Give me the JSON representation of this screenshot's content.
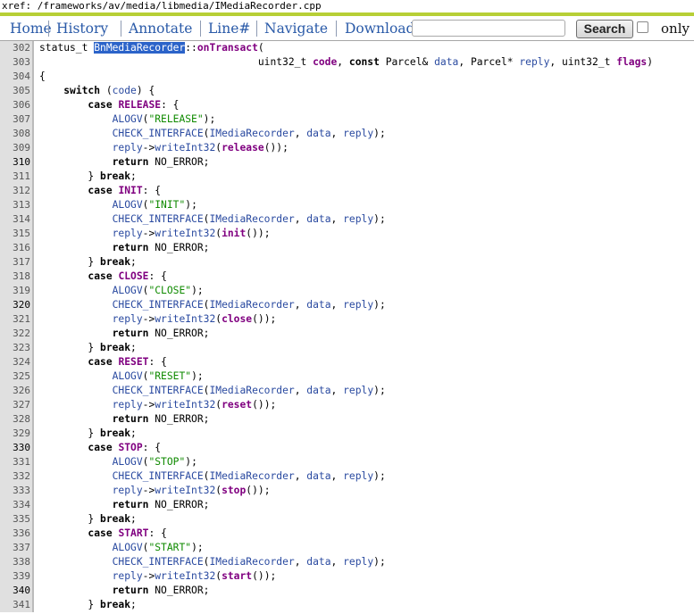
{
  "xref_path": "xref: /frameworks/av/media/libmedia/IMediaRecorder.cpp",
  "nav": {
    "home": "Home",
    "history": "History",
    "annotate": "Annotate",
    "line": "Line#",
    "navigate": "Navigate",
    "download": "Download",
    "search_button": "Search",
    "search_value": "",
    "only_label": "only"
  },
  "colors": {
    "accent_bar": "#b7cf36",
    "link": "#2a5aa8",
    "gutter": "#e0e0e0",
    "highlight": "#2b63c9"
  },
  "code": [
    {
      "n": "302",
      "s": [
        [
          "t",
          "status_t "
        ],
        [
          "hl",
          "BnMediaRecorder"
        ],
        [
          "t",
          "::"
        ],
        [
          "fn",
          "onTransact"
        ],
        [
          "t",
          "("
        ]
      ]
    },
    {
      "n": "303",
      "s": [
        [
          "t",
          "                                    uint32_t "
        ],
        [
          "fn",
          "code"
        ],
        [
          "t",
          ", "
        ],
        [
          "kw",
          "const"
        ],
        [
          "t",
          " Parcel& "
        ],
        [
          "id",
          "data"
        ],
        [
          "t",
          ", Parcel* "
        ],
        [
          "id",
          "reply"
        ],
        [
          "t",
          ", uint32_t "
        ],
        [
          "fn",
          "flags"
        ],
        [
          "t",
          ")"
        ]
      ]
    },
    {
      "n": "304",
      "s": [
        [
          "t",
          "{"
        ]
      ]
    },
    {
      "n": "305",
      "s": [
        [
          "t",
          "    "
        ],
        [
          "kw",
          "switch"
        ],
        [
          "t",
          " ("
        ],
        [
          "id",
          "code"
        ],
        [
          "t",
          ") {"
        ]
      ]
    },
    {
      "n": "306",
      "s": [
        [
          "t",
          "        "
        ],
        [
          "kw",
          "case"
        ],
        [
          "t",
          " "
        ],
        [
          "fn",
          "RELEASE"
        ],
        [
          "t",
          ": {"
        ]
      ]
    },
    {
      "n": "307",
      "s": [
        [
          "t",
          "            "
        ],
        [
          "id",
          "ALOGV"
        ],
        [
          "t",
          "("
        ],
        [
          "str",
          "\"RELEASE\""
        ],
        [
          "t",
          ");"
        ]
      ]
    },
    {
      "n": "308",
      "s": [
        [
          "t",
          "            "
        ],
        [
          "id",
          "CHECK_INTERFACE"
        ],
        [
          "t",
          "("
        ],
        [
          "id",
          "IMediaRecorder"
        ],
        [
          "t",
          ", "
        ],
        [
          "id",
          "data"
        ],
        [
          "t",
          ", "
        ],
        [
          "id",
          "reply"
        ],
        [
          "t",
          ");"
        ]
      ]
    },
    {
      "n": "309",
      "s": [
        [
          "t",
          "            "
        ],
        [
          "id",
          "reply"
        ],
        [
          "t",
          "->"
        ],
        [
          "id",
          "writeInt32"
        ],
        [
          "t",
          "("
        ],
        [
          "fn",
          "release"
        ],
        [
          "t",
          "());"
        ]
      ]
    },
    {
      "n": "310",
      "m": true,
      "s": [
        [
          "t",
          "            "
        ],
        [
          "kw",
          "return"
        ],
        [
          "t",
          " NO_ERROR;"
        ]
      ]
    },
    {
      "n": "311",
      "s": [
        [
          "t",
          "        } "
        ],
        [
          "kw",
          "break"
        ],
        [
          "t",
          ";"
        ]
      ]
    },
    {
      "n": "312",
      "s": [
        [
          "t",
          "        "
        ],
        [
          "kw",
          "case"
        ],
        [
          "t",
          " "
        ],
        [
          "fn",
          "INIT"
        ],
        [
          "t",
          ": {"
        ]
      ]
    },
    {
      "n": "313",
      "s": [
        [
          "t",
          "            "
        ],
        [
          "id",
          "ALOGV"
        ],
        [
          "t",
          "("
        ],
        [
          "str",
          "\"INIT\""
        ],
        [
          "t",
          ");"
        ]
      ]
    },
    {
      "n": "314",
      "s": [
        [
          "t",
          "            "
        ],
        [
          "id",
          "CHECK_INTERFACE"
        ],
        [
          "t",
          "("
        ],
        [
          "id",
          "IMediaRecorder"
        ],
        [
          "t",
          ", "
        ],
        [
          "id",
          "data"
        ],
        [
          "t",
          ", "
        ],
        [
          "id",
          "reply"
        ],
        [
          "t",
          ");"
        ]
      ]
    },
    {
      "n": "315",
      "s": [
        [
          "t",
          "            "
        ],
        [
          "id",
          "reply"
        ],
        [
          "t",
          "->"
        ],
        [
          "id",
          "writeInt32"
        ],
        [
          "t",
          "("
        ],
        [
          "fn",
          "init"
        ],
        [
          "t",
          "());"
        ]
      ]
    },
    {
      "n": "316",
      "s": [
        [
          "t",
          "            "
        ],
        [
          "kw",
          "return"
        ],
        [
          "t",
          " NO_ERROR;"
        ]
      ]
    },
    {
      "n": "317",
      "s": [
        [
          "t",
          "        } "
        ],
        [
          "kw",
          "break"
        ],
        [
          "t",
          ";"
        ]
      ]
    },
    {
      "n": "318",
      "s": [
        [
          "t",
          "        "
        ],
        [
          "kw",
          "case"
        ],
        [
          "t",
          " "
        ],
        [
          "fn",
          "CLOSE"
        ],
        [
          "t",
          ": {"
        ]
      ]
    },
    {
      "n": "319",
      "s": [
        [
          "t",
          "            "
        ],
        [
          "id",
          "ALOGV"
        ],
        [
          "t",
          "("
        ],
        [
          "str",
          "\"CLOSE\""
        ],
        [
          "t",
          ");"
        ]
      ]
    },
    {
      "n": "320",
      "m": true,
      "s": [
        [
          "t",
          "            "
        ],
        [
          "id",
          "CHECK_INTERFACE"
        ],
        [
          "t",
          "("
        ],
        [
          "id",
          "IMediaRecorder"
        ],
        [
          "t",
          ", "
        ],
        [
          "id",
          "data"
        ],
        [
          "t",
          ", "
        ],
        [
          "id",
          "reply"
        ],
        [
          "t",
          ");"
        ]
      ]
    },
    {
      "n": "321",
      "s": [
        [
          "t",
          "            "
        ],
        [
          "id",
          "reply"
        ],
        [
          "t",
          "->"
        ],
        [
          "id",
          "writeInt32"
        ],
        [
          "t",
          "("
        ],
        [
          "fn",
          "close"
        ],
        [
          "t",
          "());"
        ]
      ]
    },
    {
      "n": "322",
      "s": [
        [
          "t",
          "            "
        ],
        [
          "kw",
          "return"
        ],
        [
          "t",
          " NO_ERROR;"
        ]
      ]
    },
    {
      "n": "323",
      "s": [
        [
          "t",
          "        } "
        ],
        [
          "kw",
          "break"
        ],
        [
          "t",
          ";"
        ]
      ]
    },
    {
      "n": "324",
      "s": [
        [
          "t",
          "        "
        ],
        [
          "kw",
          "case"
        ],
        [
          "t",
          " "
        ],
        [
          "fn",
          "RESET"
        ],
        [
          "t",
          ": {"
        ]
      ]
    },
    {
      "n": "325",
      "s": [
        [
          "t",
          "            "
        ],
        [
          "id",
          "ALOGV"
        ],
        [
          "t",
          "("
        ],
        [
          "str",
          "\"RESET\""
        ],
        [
          "t",
          ");"
        ]
      ]
    },
    {
      "n": "326",
      "s": [
        [
          "t",
          "            "
        ],
        [
          "id",
          "CHECK_INTERFACE"
        ],
        [
          "t",
          "("
        ],
        [
          "id",
          "IMediaRecorder"
        ],
        [
          "t",
          ", "
        ],
        [
          "id",
          "data"
        ],
        [
          "t",
          ", "
        ],
        [
          "id",
          "reply"
        ],
        [
          "t",
          ");"
        ]
      ]
    },
    {
      "n": "327",
      "s": [
        [
          "t",
          "            "
        ],
        [
          "id",
          "reply"
        ],
        [
          "t",
          "->"
        ],
        [
          "id",
          "writeInt32"
        ],
        [
          "t",
          "("
        ],
        [
          "fn",
          "reset"
        ],
        [
          "t",
          "());"
        ]
      ]
    },
    {
      "n": "328",
      "s": [
        [
          "t",
          "            "
        ],
        [
          "kw",
          "return"
        ],
        [
          "t",
          " NO_ERROR;"
        ]
      ]
    },
    {
      "n": "329",
      "s": [
        [
          "t",
          "        } "
        ],
        [
          "kw",
          "break"
        ],
        [
          "t",
          ";"
        ]
      ]
    },
    {
      "n": "330",
      "m": true,
      "s": [
        [
          "t",
          "        "
        ],
        [
          "kw",
          "case"
        ],
        [
          "t",
          " "
        ],
        [
          "fn",
          "STOP"
        ],
        [
          "t",
          ": {"
        ]
      ]
    },
    {
      "n": "331",
      "s": [
        [
          "t",
          "            "
        ],
        [
          "id",
          "ALOGV"
        ],
        [
          "t",
          "("
        ],
        [
          "str",
          "\"STOP\""
        ],
        [
          "t",
          ");"
        ]
      ]
    },
    {
      "n": "332",
      "s": [
        [
          "t",
          "            "
        ],
        [
          "id",
          "CHECK_INTERFACE"
        ],
        [
          "t",
          "("
        ],
        [
          "id",
          "IMediaRecorder"
        ],
        [
          "t",
          ", "
        ],
        [
          "id",
          "data"
        ],
        [
          "t",
          ", "
        ],
        [
          "id",
          "reply"
        ],
        [
          "t",
          ");"
        ]
      ]
    },
    {
      "n": "333",
      "s": [
        [
          "t",
          "            "
        ],
        [
          "id",
          "reply"
        ],
        [
          "t",
          "->"
        ],
        [
          "id",
          "writeInt32"
        ],
        [
          "t",
          "("
        ],
        [
          "fn",
          "stop"
        ],
        [
          "t",
          "());"
        ]
      ]
    },
    {
      "n": "334",
      "s": [
        [
          "t",
          "            "
        ],
        [
          "kw",
          "return"
        ],
        [
          "t",
          " NO_ERROR;"
        ]
      ]
    },
    {
      "n": "335",
      "s": [
        [
          "t",
          "        } "
        ],
        [
          "kw",
          "break"
        ],
        [
          "t",
          ";"
        ]
      ]
    },
    {
      "n": "336",
      "s": [
        [
          "t",
          "        "
        ],
        [
          "kw",
          "case"
        ],
        [
          "t",
          " "
        ],
        [
          "fn",
          "START"
        ],
        [
          "t",
          ": {"
        ]
      ]
    },
    {
      "n": "337",
      "s": [
        [
          "t",
          "            "
        ],
        [
          "id",
          "ALOGV"
        ],
        [
          "t",
          "("
        ],
        [
          "str",
          "\"START\""
        ],
        [
          "t",
          ");"
        ]
      ]
    },
    {
      "n": "338",
      "s": [
        [
          "t",
          "            "
        ],
        [
          "id",
          "CHECK_INTERFACE"
        ],
        [
          "t",
          "("
        ],
        [
          "id",
          "IMediaRecorder"
        ],
        [
          "t",
          ", "
        ],
        [
          "id",
          "data"
        ],
        [
          "t",
          ", "
        ],
        [
          "id",
          "reply"
        ],
        [
          "t",
          ");"
        ]
      ]
    },
    {
      "n": "339",
      "s": [
        [
          "t",
          "            "
        ],
        [
          "id",
          "reply"
        ],
        [
          "t",
          "->"
        ],
        [
          "id",
          "writeInt32"
        ],
        [
          "t",
          "("
        ],
        [
          "fn",
          "start"
        ],
        [
          "t",
          "());"
        ]
      ]
    },
    {
      "n": "340",
      "m": true,
      "s": [
        [
          "t",
          "            "
        ],
        [
          "kw",
          "return"
        ],
        [
          "t",
          " NO_ERROR;"
        ]
      ]
    },
    {
      "n": "341",
      "s": [
        [
          "t",
          "        } "
        ],
        [
          "kw",
          "break"
        ],
        [
          "t",
          ";"
        ]
      ]
    }
  ]
}
